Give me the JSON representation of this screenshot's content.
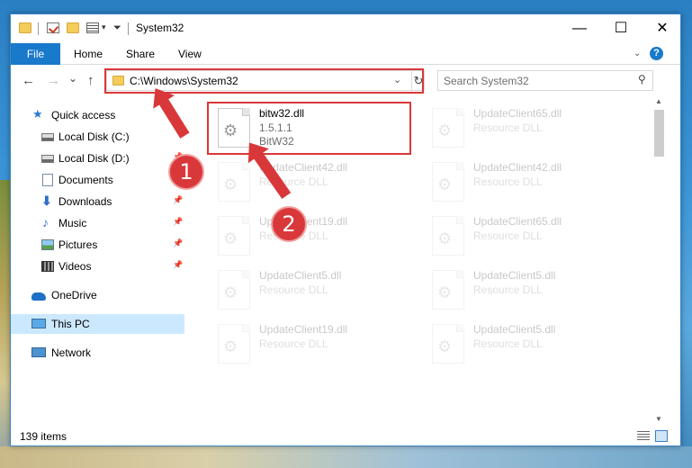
{
  "window": {
    "title": "System32",
    "controls": {
      "minimize": "—",
      "maximize": "☐",
      "close": "✕"
    }
  },
  "ribbon": {
    "file_tab": "File",
    "tabs": [
      "Home",
      "Share",
      "View"
    ],
    "help": "?"
  },
  "navigation": {
    "back": "←",
    "forward": "→",
    "recent": "⌄",
    "up": "↑",
    "address": "C:\\Windows\\System32",
    "search_placeholder": "Search System32"
  },
  "sidebar": {
    "items": [
      {
        "label": "Quick access",
        "icon": "quick-access-star-icon",
        "pinned": false
      },
      {
        "label": "Local Disk (C:)",
        "icon": "drive-icon",
        "pinned": false
      },
      {
        "label": "Local Disk (D:)",
        "icon": "drive-icon",
        "pinned": true
      },
      {
        "label": "Documents",
        "icon": "documents-icon",
        "pinned": true
      },
      {
        "label": "Downloads",
        "icon": "downloads-icon",
        "pinned": true
      },
      {
        "label": "Music",
        "icon": "music-icon",
        "pinned": true
      },
      {
        "label": "Pictures",
        "icon": "pictures-icon",
        "pinned": true
      },
      {
        "label": "Videos",
        "icon": "videos-icon",
        "pinned": true
      },
      {
        "label": "OneDrive",
        "icon": "onedrive-icon",
        "pinned": false
      },
      {
        "label": "This PC",
        "icon": "this-pc-icon",
        "pinned": false,
        "selected": true
      },
      {
        "label": "Network",
        "icon": "network-icon",
        "pinned": false
      }
    ]
  },
  "files": [
    {
      "name": "bitw32.dll",
      "line2": "1.5.1.1",
      "line3": "BitW32",
      "highlighted": true
    },
    {
      "name": "UpdateClient65.dll",
      "line2": "Resource DLL"
    },
    {
      "name": "UpdateClient42.dll",
      "line2": "Resource DLL"
    },
    {
      "name": "UpdateClient42.dll",
      "line2": "Resource DLL"
    },
    {
      "name": "UpdateClient19.dll",
      "line2": "Resource DLL"
    },
    {
      "name": "UpdateClient65.dll",
      "line2": "Resource DLL"
    },
    {
      "name": "UpdateClient5.dll",
      "line2": "Resource DLL"
    },
    {
      "name": "UpdateClient5.dll",
      "line2": "Resource DLL"
    },
    {
      "name": "UpdateClient19.dll",
      "line2": "Resource DLL"
    },
    {
      "name": "UpdateClient5.dll",
      "line2": "Resource DLL"
    }
  ],
  "status": {
    "item_count": "139 items"
  },
  "annotations": {
    "badge1": "1",
    "badge2": "2",
    "color": "#d9383a"
  }
}
